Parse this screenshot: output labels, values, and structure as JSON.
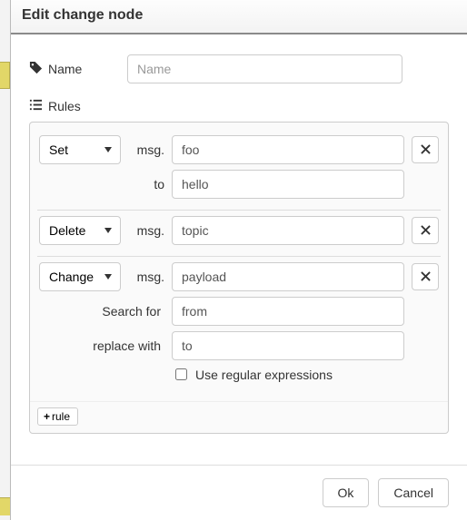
{
  "header": {
    "title": "Edit change node"
  },
  "form": {
    "name": {
      "label": "Name",
      "placeholder": "Name",
      "value": ""
    },
    "rules_label": "Rules"
  },
  "rule_types": [
    "Set",
    "Change",
    "Delete"
  ],
  "msg_label": "msg.",
  "rules": [
    {
      "type": "Set",
      "property": "foo",
      "to_label": "to",
      "to_value": "hello"
    },
    {
      "type": "Delete",
      "property": "topic"
    },
    {
      "type": "Change",
      "property": "payload",
      "search_label": "Search for",
      "search_value": "from",
      "replace_label": "replace with",
      "replace_value": "to",
      "regex_label": "Use regular expressions",
      "regex_checked": false
    }
  ],
  "add_rule_label": "rule",
  "footer": {
    "ok": "Ok",
    "cancel": "Cancel"
  }
}
